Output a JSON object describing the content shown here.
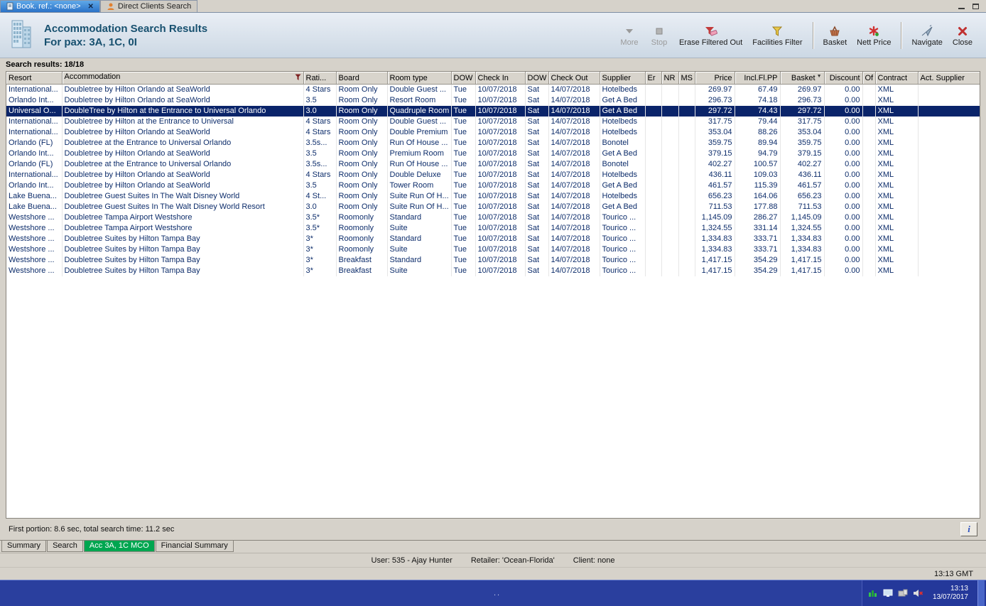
{
  "window_tabs": {
    "booking": {
      "label": "Book. ref.: <none>"
    },
    "direct_clients": {
      "label": "Direct Clients Search"
    }
  },
  "header": {
    "title": "Accommodation Search Results",
    "subtitle": "For pax: 3A, 1C, 0I",
    "toolbar": {
      "more": "More",
      "stop": "Stop",
      "erase_filtered": "Erase Filtered Out",
      "facilities_filter": "Facilities Filter",
      "basket": "Basket",
      "nett_price": "Nett Price",
      "navigate": "Navigate",
      "close": "Close"
    }
  },
  "results_label": "Search results: 18/18",
  "table": {
    "columns": [
      {
        "key": "resort",
        "label": "Resort"
      },
      {
        "key": "accommodation",
        "label": "Accommodation",
        "filter_icon": true
      },
      {
        "key": "rating",
        "label": "Rati..."
      },
      {
        "key": "board",
        "label": "Board"
      },
      {
        "key": "room_type",
        "label": "Room type"
      },
      {
        "key": "dow_in",
        "label": "DOW"
      },
      {
        "key": "check_in",
        "label": "Check In"
      },
      {
        "key": "dow_out",
        "label": "DOW"
      },
      {
        "key": "check_out",
        "label": "Check Out"
      },
      {
        "key": "supplier",
        "label": "Supplier"
      },
      {
        "key": "er",
        "label": "Er"
      },
      {
        "key": "nr",
        "label": "NR"
      },
      {
        "key": "ms",
        "label": "MS"
      },
      {
        "key": "price",
        "label": "Price",
        "align": "right"
      },
      {
        "key": "incl_fl_pp",
        "label": "Incl.Fl.PP",
        "align": "right"
      },
      {
        "key": "basket",
        "label": "Basket",
        "align": "right",
        "sort": "desc"
      },
      {
        "key": "discount",
        "label": "Discount",
        "align": "right"
      },
      {
        "key": "of",
        "label": "Of"
      },
      {
        "key": "contract",
        "label": "Contract"
      },
      {
        "key": "act_supplier",
        "label": "Act. Supplier"
      }
    ],
    "rows": [
      {
        "resort": "International...",
        "accommodation": "Doubletree by Hilton Orlando at SeaWorld",
        "rating": "4 Stars",
        "board": "Room Only",
        "room_type": "Double Guest ...",
        "dow_in": "Tue",
        "check_in": "10/07/2018",
        "dow_out": "Sat",
        "check_out": "14/07/2018",
        "supplier": "Hotelbeds",
        "price": "269.97",
        "incl_fl_pp": "67.49",
        "basket": "269.97",
        "discount": "0.00",
        "contract": "XML"
      },
      {
        "resort": "Orlando Int...",
        "accommodation": "Doubletree by Hilton Orlando at SeaWorld",
        "rating": "3.5",
        "board": "Room Only",
        "room_type": "Resort Room",
        "dow_in": "Tue",
        "check_in": "10/07/2018",
        "dow_out": "Sat",
        "check_out": "14/07/2018",
        "supplier": "Get A Bed",
        "price": "296.73",
        "incl_fl_pp": "74.18",
        "basket": "296.73",
        "discount": "0.00",
        "contract": "XML"
      },
      {
        "resort": "Universal O...",
        "accommodation": "DoubleTree by Hilton at the Entrance to Universal Orlando",
        "rating": "3.0",
        "board": "Room Only",
        "room_type": "Quadruple Room",
        "dow_in": "Tue",
        "check_in": "10/07/2018",
        "dow_out": "Sat",
        "check_out": "14/07/2018",
        "supplier": "Get A Bed",
        "price": "297.72",
        "incl_fl_pp": "74.43",
        "basket": "297.72",
        "discount": "0.00",
        "contract": "XML",
        "selected": true
      },
      {
        "resort": "International...",
        "accommodation": "Doubletree by Hilton at the Entrance to Universal",
        "rating": "4 Stars",
        "board": "Room Only",
        "room_type": "Double Guest ...",
        "dow_in": "Tue",
        "check_in": "10/07/2018",
        "dow_out": "Sat",
        "check_out": "14/07/2018",
        "supplier": "Hotelbeds",
        "price": "317.75",
        "incl_fl_pp": "79.44",
        "basket": "317.75",
        "discount": "0.00",
        "contract": "XML"
      },
      {
        "resort": "International...",
        "accommodation": "Doubletree by Hilton Orlando at SeaWorld",
        "rating": "4 Stars",
        "board": "Room Only",
        "room_type": "Double Premium",
        "dow_in": "Tue",
        "check_in": "10/07/2018",
        "dow_out": "Sat",
        "check_out": "14/07/2018",
        "supplier": "Hotelbeds",
        "price": "353.04",
        "incl_fl_pp": "88.26",
        "basket": "353.04",
        "discount": "0.00",
        "contract": "XML"
      },
      {
        "resort": "Orlando (FL)",
        "accommodation": "Doubletree at the Entrance to Universal Orlando",
        "rating": "3.5s...",
        "board": "Room Only",
        "room_type": "Run Of House ...",
        "dow_in": "Tue",
        "check_in": "10/07/2018",
        "dow_out": "Sat",
        "check_out": "14/07/2018",
        "supplier": "Bonotel",
        "price": "359.75",
        "incl_fl_pp": "89.94",
        "basket": "359.75",
        "discount": "0.00",
        "contract": "XML"
      },
      {
        "resort": "Orlando Int...",
        "accommodation": "Doubletree by Hilton Orlando at SeaWorld",
        "rating": "3.5",
        "board": "Room Only",
        "room_type": "Premium Room",
        "dow_in": "Tue",
        "check_in": "10/07/2018",
        "dow_out": "Sat",
        "check_out": "14/07/2018",
        "supplier": "Get A Bed",
        "price": "379.15",
        "incl_fl_pp": "94.79",
        "basket": "379.15",
        "discount": "0.00",
        "contract": "XML"
      },
      {
        "resort": "Orlando (FL)",
        "accommodation": "Doubletree at the Entrance to Universal Orlando",
        "rating": "3.5s...",
        "board": "Room Only",
        "room_type": "Run Of House ...",
        "dow_in": "Tue",
        "check_in": "10/07/2018",
        "dow_out": "Sat",
        "check_out": "14/07/2018",
        "supplier": "Bonotel",
        "price": "402.27",
        "incl_fl_pp": "100.57",
        "basket": "402.27",
        "discount": "0.00",
        "contract": "XML"
      },
      {
        "resort": "International...",
        "accommodation": "Doubletree by Hilton Orlando at SeaWorld",
        "rating": "4 Stars",
        "board": "Room Only",
        "room_type": "Double Deluxe",
        "dow_in": "Tue",
        "check_in": "10/07/2018",
        "dow_out": "Sat",
        "check_out": "14/07/2018",
        "supplier": "Hotelbeds",
        "price": "436.11",
        "incl_fl_pp": "109.03",
        "basket": "436.11",
        "discount": "0.00",
        "contract": "XML"
      },
      {
        "resort": "Orlando Int...",
        "accommodation": "Doubletree by Hilton Orlando at SeaWorld",
        "rating": "3.5",
        "board": "Room Only",
        "room_type": "Tower Room",
        "dow_in": "Tue",
        "check_in": "10/07/2018",
        "dow_out": "Sat",
        "check_out": "14/07/2018",
        "supplier": "Get A Bed",
        "price": "461.57",
        "incl_fl_pp": "115.39",
        "basket": "461.57",
        "discount": "0.00",
        "contract": "XML"
      },
      {
        "resort": "Lake Buena...",
        "accommodation": "Doubletree Guest Suites In The Walt Disney World",
        "rating": "4 St...",
        "board": "Room Only",
        "room_type": "Suite Run Of H...",
        "dow_in": "Tue",
        "check_in": "10/07/2018",
        "dow_out": "Sat",
        "check_out": "14/07/2018",
        "supplier": "Hotelbeds",
        "price": "656.23",
        "incl_fl_pp": "164.06",
        "basket": "656.23",
        "discount": "0.00",
        "contract": "XML"
      },
      {
        "resort": "Lake Buena...",
        "accommodation": "Doubletree Guest Suites In The Walt Disney World Resort",
        "rating": "3.0",
        "board": "Room Only",
        "room_type": "Suite Run Of H...",
        "dow_in": "Tue",
        "check_in": "10/07/2018",
        "dow_out": "Sat",
        "check_out": "14/07/2018",
        "supplier": "Get A Bed",
        "price": "711.53",
        "incl_fl_pp": "177.88",
        "basket": "711.53",
        "discount": "0.00",
        "contract": "XML"
      },
      {
        "resort": "Westshore ...",
        "accommodation": "Doubletree Tampa Airport Westshore",
        "rating": "3.5*",
        "board": "Roomonly",
        "room_type": "Standard",
        "dow_in": "Tue",
        "check_in": "10/07/2018",
        "dow_out": "Sat",
        "check_out": "14/07/2018",
        "supplier": "Tourico ...",
        "price": "1,145.09",
        "incl_fl_pp": "286.27",
        "basket": "1,145.09",
        "discount": "0.00",
        "contract": "XML"
      },
      {
        "resort": "Westshore ...",
        "accommodation": "Doubletree Tampa Airport Westshore",
        "rating": "3.5*",
        "board": "Roomonly",
        "room_type": "Suite",
        "dow_in": "Tue",
        "check_in": "10/07/2018",
        "dow_out": "Sat",
        "check_out": "14/07/2018",
        "supplier": "Tourico ...",
        "price": "1,324.55",
        "incl_fl_pp": "331.14",
        "basket": "1,324.55",
        "discount": "0.00",
        "contract": "XML"
      },
      {
        "resort": "Westshore ...",
        "accommodation": "Doubletree Suites by Hilton Tampa Bay",
        "rating": "3*",
        "board": "Roomonly",
        "room_type": "Standard",
        "dow_in": "Tue",
        "check_in": "10/07/2018",
        "dow_out": "Sat",
        "check_out": "14/07/2018",
        "supplier": "Tourico ...",
        "price": "1,334.83",
        "incl_fl_pp": "333.71",
        "basket": "1,334.83",
        "discount": "0.00",
        "contract": "XML"
      },
      {
        "resort": "Westshore ...",
        "accommodation": "Doubletree Suites by Hilton Tampa Bay",
        "rating": "3*",
        "board": "Roomonly",
        "room_type": "Suite",
        "dow_in": "Tue",
        "check_in": "10/07/2018",
        "dow_out": "Sat",
        "check_out": "14/07/2018",
        "supplier": "Tourico ...",
        "price": "1,334.83",
        "incl_fl_pp": "333.71",
        "basket": "1,334.83",
        "discount": "0.00",
        "contract": "XML"
      },
      {
        "resort": "Westshore ...",
        "accommodation": "Doubletree Suites by Hilton Tampa Bay",
        "rating": "3*",
        "board": "Breakfast",
        "room_type": "Standard",
        "dow_in": "Tue",
        "check_in": "10/07/2018",
        "dow_out": "Sat",
        "check_out": "14/07/2018",
        "supplier": "Tourico ...",
        "price": "1,417.15",
        "incl_fl_pp": "354.29",
        "basket": "1,417.15",
        "discount": "0.00",
        "contract": "XML"
      },
      {
        "resort": "Westshore ...",
        "accommodation": "Doubletree Suites by Hilton Tampa Bay",
        "rating": "3*",
        "board": "Breakfast",
        "room_type": "Suite",
        "dow_in": "Tue",
        "check_in": "10/07/2018",
        "dow_out": "Sat",
        "check_out": "14/07/2018",
        "supplier": "Tourico ...",
        "price": "1,417.15",
        "incl_fl_pp": "354.29",
        "basket": "1,417.15",
        "discount": "0.00",
        "contract": "XML"
      }
    ]
  },
  "status": {
    "timing": "First portion: 8.6 sec, total search time: 11.2 sec",
    "info": "i"
  },
  "bottom_tabs": {
    "summary": "Summary",
    "search": "Search",
    "acc": "Acc 3A, 1C MCO",
    "financial": "Financial Summary"
  },
  "status_bar": {
    "user": "User: 535 - Ajay Hunter",
    "retailer": "Retailer: 'Ocean-Florida'",
    "client": "Client: none",
    "gmt": "13:13 GMT"
  },
  "taskbar": {
    "dots": "..",
    "time": "13:13",
    "date": "13/07/2017"
  },
  "colors": {
    "selected_row": "#0a246a",
    "active_tab": "#2a72c8",
    "green_tab": "#00a650",
    "taskbar": "#2a3f9e",
    "title_text": "#17506f"
  }
}
